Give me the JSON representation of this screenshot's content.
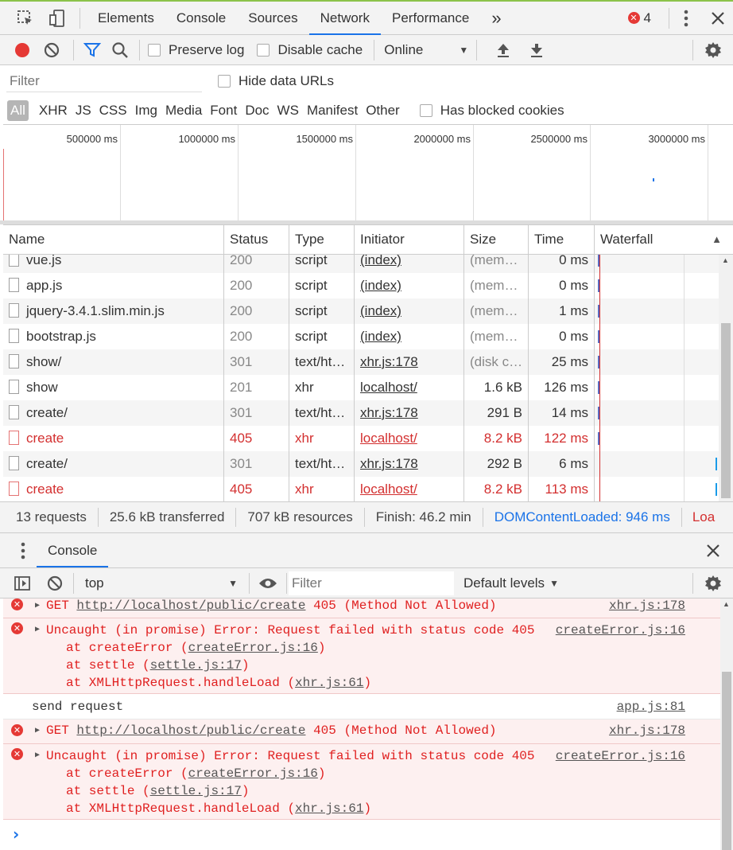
{
  "toolbar": {
    "tabs": [
      "Elements",
      "Console",
      "Sources",
      "Network",
      "Performance"
    ],
    "more": "»",
    "error_count": "4"
  },
  "net_toolbar": {
    "preserve_log": "Preserve log",
    "disable_cache": "Disable cache",
    "throttle": "Online"
  },
  "filter": {
    "placeholder": "Filter",
    "hide_data_urls": "Hide data URLs",
    "types": [
      "All",
      "XHR",
      "JS",
      "CSS",
      "Img",
      "Media",
      "Font",
      "Doc",
      "WS",
      "Manifest",
      "Other"
    ],
    "has_blocked_cookies": "Has blocked cookies"
  },
  "overview": {
    "ticks": [
      "500000 ms",
      "1000000 ms",
      "1500000 ms",
      "2000000 ms",
      "2500000 ms",
      "3000000 ms"
    ]
  },
  "table": {
    "headers": [
      "Name",
      "Status",
      "Type",
      "Initiator",
      "Size",
      "Time",
      "Waterfall"
    ],
    "rows": [
      {
        "name": "vue.js",
        "status": "200",
        "type": "script",
        "initiator": "(index)",
        "size": "(mem…",
        "time": "0 ms",
        "kind": "script"
      },
      {
        "name": "app.js",
        "status": "200",
        "type": "script",
        "initiator": "(index)",
        "size": "(mem…",
        "time": "0 ms",
        "kind": "script"
      },
      {
        "name": "jquery-3.4.1.slim.min.js",
        "status": "200",
        "type": "script",
        "initiator": "(index)",
        "size": "(mem…",
        "time": "1 ms",
        "kind": "script"
      },
      {
        "name": "bootstrap.js",
        "status": "200",
        "type": "script",
        "initiator": "(index)",
        "size": "(mem…",
        "time": "0 ms",
        "kind": "script"
      },
      {
        "name": "show/",
        "status": "301",
        "type": "text/ht…",
        "initiator": "xhr.js:178",
        "size": "(disk c…",
        "time": "25 ms",
        "kind": "doc"
      },
      {
        "name": "show",
        "status": "201",
        "type": "xhr",
        "initiator": "localhost/",
        "size": "1.6 kB",
        "time": "126 ms",
        "kind": "doc"
      },
      {
        "name": "create/",
        "status": "301",
        "type": "text/ht…",
        "initiator": "xhr.js:178",
        "size": "291 B",
        "time": "14 ms",
        "kind": "doc"
      },
      {
        "name": "create",
        "status": "405",
        "type": "xhr",
        "initiator": "localhost/",
        "size": "8.2 kB",
        "time": "122 ms",
        "kind": "error"
      },
      {
        "name": "create/",
        "status": "301",
        "type": "text/ht…",
        "initiator": "xhr.js:178",
        "size": "292 B",
        "time": "6 ms",
        "kind": "doc"
      },
      {
        "name": "create",
        "status": "405",
        "type": "xhr",
        "initiator": "localhost/",
        "size": "8.2 kB",
        "time": "113 ms",
        "kind": "error"
      }
    ]
  },
  "summary": {
    "requests": "13 requests",
    "transferred": "25.6 kB transferred",
    "resources": "707 kB resources",
    "finish": "Finish: 46.2 min",
    "dcl": "DOMContentLoaded: 946 ms",
    "load": "Loa"
  },
  "drawer": {
    "tab": "Console"
  },
  "console_toolbar": {
    "context": "top",
    "filter_placeholder": "Filter",
    "levels": "Default levels"
  },
  "console": {
    "get1": {
      "method": "GET",
      "url": "http://localhost/public/create",
      "status": "405 (Method Not Allowed)",
      "src": "xhr.js:178"
    },
    "err1": {
      "msg": "Uncaught (in promise) Error: Request failed with status code 405",
      "src": "createError.js:16",
      "stack": [
        {
          "pre": "at createError (",
          "link": "createError.js:16",
          "post": ")"
        },
        {
          "pre": "at settle (",
          "link": "settle.js:17",
          "post": ")"
        },
        {
          "pre": "at XMLHttpRequest.handleLoad (",
          "link": "xhr.js:61",
          "post": ")"
        }
      ]
    },
    "log": {
      "msg": "send request",
      "src": "app.js:81"
    },
    "get2": {
      "method": "GET",
      "url": "http://localhost/public/create",
      "status": "405 (Method Not Allowed)",
      "src": "xhr.js:178"
    },
    "err2": {
      "msg": "Uncaught (in promise) Error: Request failed with status code 405",
      "src": "createError.js:16",
      "stack": [
        {
          "pre": "at createError (",
          "link": "createError.js:16",
          "post": ")"
        },
        {
          "pre": "at settle (",
          "link": "settle.js:17",
          "post": ")"
        },
        {
          "pre": "at XMLHttpRequest.handleLoad (",
          "link": "xhr.js:61",
          "post": ")"
        }
      ]
    },
    "prompt": "›"
  },
  "colors": {
    "accent": "#1a73e8",
    "error": "#d32f2f",
    "error_bg": "#fdf0f0",
    "record": "#e53935"
  }
}
